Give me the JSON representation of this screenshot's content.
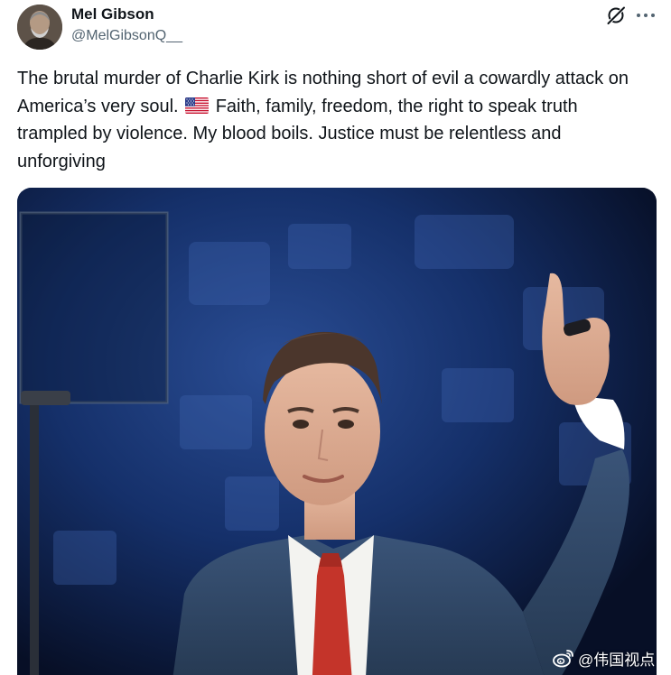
{
  "post": {
    "author": {
      "name": "Mel Gibson",
      "handle": "@MelGibsonQ__",
      "avatar_icon": "profile-avatar"
    },
    "text_part1": "The brutal murder of Charlie Kirk is nothing short of evil a cowardly attack on America’s very soul.",
    "text_flag": "us-flag-emoji",
    "text_part2": "Faith, family, freedom, the right to speak truth trampled by violence. My blood boils. Justice must be relentless and unforgiving",
    "actions": {
      "grok_icon": "grok-icon",
      "more_icon": "more-options-icon"
    },
    "media": {
      "type": "photo",
      "watermark": "@伟国视点",
      "watermark_icon": "weibo-logo-icon"
    }
  },
  "colors": {
    "text": "#0f1419",
    "secondary_text": "#536471",
    "background": "#ffffff"
  }
}
